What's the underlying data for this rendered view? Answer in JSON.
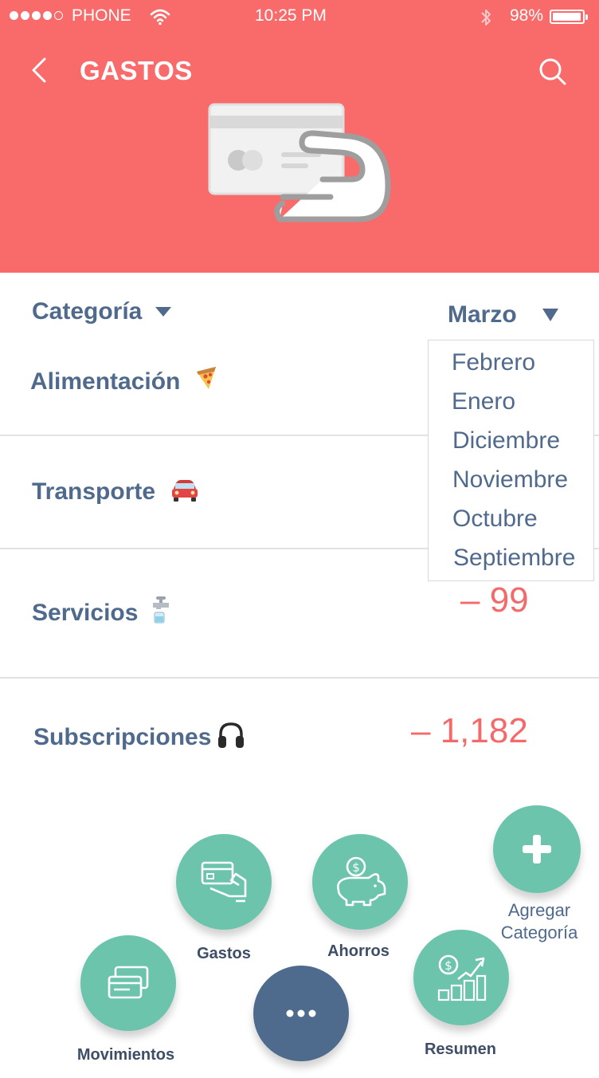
{
  "status_bar": {
    "carrier": "PHONE",
    "time": "10:25 PM",
    "battery": "98%"
  },
  "header": {
    "title": "GASTOS"
  },
  "filters": {
    "category_label": "Categoría",
    "month_label": "Marzo"
  },
  "months_dropdown": [
    "Febrero",
    "Enero",
    "Diciembre",
    "Noviembre",
    "Octubre",
    "Septiembre"
  ],
  "rows": [
    {
      "label": "Alimentación",
      "icon": "pizza-icon",
      "amount": ""
    },
    {
      "label": "Transporte",
      "icon": "car-icon",
      "amount": ""
    },
    {
      "label": "Servicios",
      "icon": "faucet-icon",
      "amount": "– 99"
    },
    {
      "label": "Subscripciones",
      "icon": "headphones-icon",
      "amount": "– 1,182"
    }
  ],
  "menu": {
    "gastos": "Gastos",
    "ahorros": "Ahorros",
    "movimientos": "Movimientos",
    "resumen": "Resumen",
    "agregar_line1": "Agregar",
    "agregar_line2": "Categoría"
  },
  "colors": {
    "header_bg": "#f96b6b",
    "accent_green": "#6cc4ad",
    "navy": "#4f6a8c",
    "amount_red": "#f46a6a"
  }
}
